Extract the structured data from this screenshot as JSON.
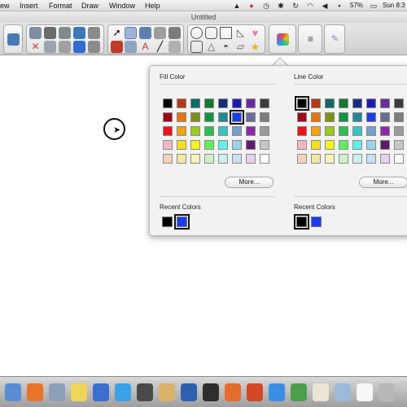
{
  "menubar": {
    "items": [
      "ew",
      "Insert",
      "Format",
      "Draw",
      "Window",
      "Help"
    ],
    "battery": "57%",
    "clock": "Sun 8:3"
  },
  "window": {
    "title": "Untitled"
  },
  "toolbar": {
    "icons": [
      "presentation-icon",
      "new-page-icon",
      "image-icon",
      "gallery-icon",
      "settings-icon",
      "undo-icon",
      "delete-icon",
      "screen-icon",
      "table-icon",
      "export-icon",
      "crop-icon",
      "select-arrow-icon",
      "pen-icon",
      "highlighter-icon",
      "magic-pen-icon",
      "brush-icon",
      "creative-pen-icon",
      "eraser-icon",
      "text-icon",
      "line-icon",
      "fill-icon",
      "circle-shape-icon",
      "rounded-rect-icon",
      "rect-shape-icon",
      "triangle-shape-icon",
      "heart-shape-icon",
      "square-shape-icon",
      "triangle-outline-icon",
      "half-circle-icon",
      "parallelogram-icon",
      "star-shape-icon",
      "color-picker-icon",
      "line-width-icon",
      "attach-icon"
    ]
  },
  "popover": {
    "fill": {
      "title": "Fill Color",
      "more_label": "More...",
      "recent_title": "Recent Colors",
      "selected_index": 13,
      "swatches": [
        "#000000",
        "#b33a14",
        "#0f6a68",
        "#117a2c",
        "#152f7f",
        "#1b1bb4",
        "#6a2ca0",
        "#3d3d3d",
        "#9c0b16",
        "#e4760f",
        "#7f8f1a",
        "#0f9440",
        "#1c8b94",
        "#1a3ee8",
        "#6c6c9c",
        "#7c7c7c",
        "#ec1218",
        "#f5a211",
        "#9ccd1a",
        "#2cbd53",
        "#36c4c4",
        "#7a9ecf",
        "#8e26a8",
        "#9c9c9c",
        "#f8b4c6",
        "#f8e016",
        "#f2f222",
        "#5cf05c",
        "#5ef0ec",
        "#9bd2f0",
        "#5e1a6e",
        "#c7c7c7",
        "#f2d3b6",
        "#f6e6a1",
        "#f7f5b8",
        "#cdf2c7",
        "#c9f2ee",
        "#c9e0f4",
        "#e5d0ef",
        "#ffffff"
      ],
      "recent": [
        "#000000",
        "#1a3ee8"
      ],
      "recent_selected": 1
    },
    "line": {
      "title": "Line Color",
      "more_label": "More...",
      "recent_title": "Recent Colors",
      "selected_index": 0,
      "swatches": [
        "#000000",
        "#b33a14",
        "#0f6a68",
        "#117a2c",
        "#152f7f",
        "#1b1bb4",
        "#6a2ca0",
        "#3d3d3d",
        "#9c0b16",
        "#e4760f",
        "#7f8f1a",
        "#0f9440",
        "#1c8b94",
        "#1a3ee8",
        "#6c6c9c",
        "#7c7c7c",
        "#ec1218",
        "#f5a211",
        "#9ccd1a",
        "#2cbd53",
        "#36c4c4",
        "#7a9ecf",
        "#8e26a8",
        "#9c9c9c",
        "#f8b4c6",
        "#f8e016",
        "#f2f222",
        "#5cf05c",
        "#5ef0ec",
        "#9bd2f0",
        "#5e1a6e",
        "#c7c7c7",
        "#f2d3b6",
        "#f6e6a1",
        "#f7f5b8",
        "#cdf2c7",
        "#c9f2ee",
        "#c9e0f4",
        "#e5d0ef",
        "#ffffff"
      ],
      "recent": [
        "#000000",
        "#1a3ee8"
      ],
      "recent_selected": 0
    }
  },
  "dock": {
    "icons": [
      "finder-icon",
      "firefox-icon",
      "mail-icon",
      "notes-icon",
      "quicktime-icon",
      "app-store-icon",
      "compass-icon",
      "photos-icon",
      "word-icon",
      "activity-monitor-icon",
      "keynote-icon",
      "powerpoint-icon",
      "edge-icon",
      "sync-icon",
      "documents-icon",
      "folder-icon",
      "help-icon",
      "trash-icon"
    ]
  }
}
